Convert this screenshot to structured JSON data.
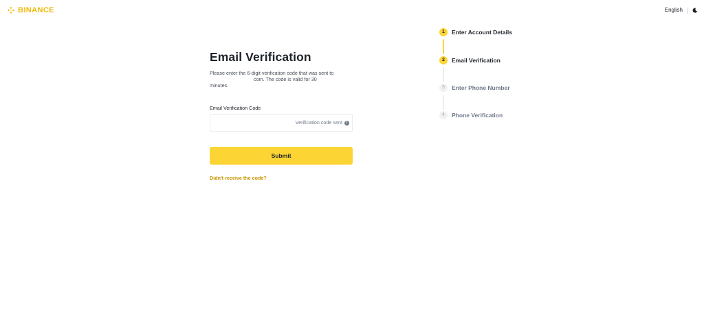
{
  "header": {
    "brand": "BINANCE",
    "brand_color": "#F0B90B",
    "language": "English",
    "theme_toggle_icon": "moon-icon"
  },
  "form": {
    "title": "Email Verification",
    "description_line1": "Please enter the 6-digit verification code that was sent to",
    "description_line2_suffix": "com. The code is valid for 30",
    "description_line3": "minutes.",
    "field_label": "Email Verification Code",
    "input_value": "",
    "sent_status": "Verification code sent",
    "info_icon": "info-icon",
    "submit_label": "Submit",
    "resend_link": "Didn't receive the code?"
  },
  "steps": [
    {
      "number": "1",
      "label": "Enter Account Details",
      "state": "completed"
    },
    {
      "number": "2",
      "label": "Email Verification",
      "state": "current"
    },
    {
      "number": "3",
      "label": "Enter Phone Number",
      "state": "pending"
    },
    {
      "number": "4",
      "label": "Phone Verification",
      "state": "pending"
    }
  ],
  "colors": {
    "accent": "#FCD535",
    "link": "#C99400",
    "text_primary": "#1E2329",
    "text_secondary": "#707A8A"
  }
}
